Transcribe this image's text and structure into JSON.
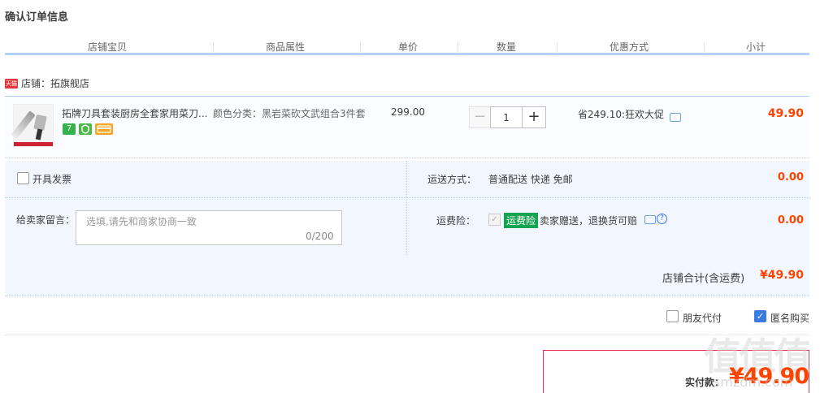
{
  "page_title": "确认订单信息",
  "columns": [
    "店铺宝贝",
    "商品属性",
    "单价",
    "数量",
    "优惠方式",
    "小计"
  ],
  "shop": {
    "badge": "天猫",
    "label": "店铺：拓旗舰店"
  },
  "item": {
    "title": "拓牌刀具套装厨房全套家用菜刀...",
    "attribute": "颜色分类：黑岩菜砍文武组合3件套",
    "price": "299.00",
    "quantity": "1",
    "minus_label": "−",
    "plus_label": "+",
    "promotion": "省249.10:狂欢大促",
    "subtotal": "49.90",
    "badge_seven": "7"
  },
  "invoice": {
    "label": "开具发票",
    "checked": false
  },
  "shipping": {
    "label": "运送方式：",
    "value": "普通配送 快递 免邮",
    "amount": "0.00"
  },
  "memo": {
    "label": "给卖家留言：",
    "placeholder": "选填,请先和商家协商一致",
    "counter": "0/200"
  },
  "insurance": {
    "label": "运费险：",
    "tag": "运费险",
    "description": "卖家赠送，退换货可赔",
    "help": "?",
    "amount": "0.00",
    "checked": true
  },
  "shop_total": {
    "label": "店铺合计(含运费)",
    "value": "¥49.90"
  },
  "friend_pay": {
    "label": "朋友代付",
    "checked": false
  },
  "anonymous": {
    "label": "匿名购买",
    "checked": true
  },
  "payment": {
    "label": "实付款：",
    "value": "¥49.90"
  },
  "watermark": {
    "text": "值值值",
    "url": "smzdm.com"
  },
  "colors": {
    "accent": "#ff4400",
    "border_blue": "#b2d1ff",
    "panel_bg": "#f2f7ff",
    "tmall_red": "#e4393c",
    "insurance_green": "#13a451"
  }
}
